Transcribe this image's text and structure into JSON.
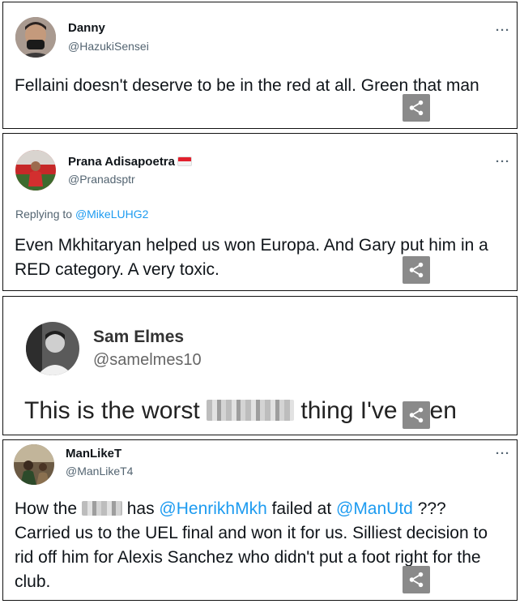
{
  "tweets": [
    {
      "name": "Danny",
      "handle": "@HazukiSensei",
      "more": "···",
      "text": "Fellaini doesn't deserve to be in the red at all. Green that man"
    },
    {
      "name": "Prana Adisapoetra",
      "flag": "indonesia-flag",
      "handle": "@Pranadsptr",
      "more": "···",
      "replying_to_prefix": "Replying to ",
      "replying_to": "@MikeLUHG2",
      "text": "Even Mkhitaryan helped us won Europa. And Gary put him in a RED category. A very toxic."
    },
    {
      "name": "Sam Elmes",
      "handle": "@samelmes10",
      "text_before": "This is the worst ",
      "text_after": " thing I've seen"
    },
    {
      "name": "ManLikeT",
      "handle": "@ManLikeT4",
      "more": "···",
      "t1": "How the ",
      "t2": " has ",
      "mention1": "@HenrikhMkh",
      "t3": " failed at ",
      "mention2": "@ManUtd",
      "t4": " ??? Carried us to the UEL final and won it for us. Silliest decision to rid off him for Alexis Sanchez who didn't put a foot right for the club."
    }
  ],
  "icons": {
    "share": "share-icon",
    "more": "more-icon"
  },
  "colors": {
    "mention": "#1d9bf0",
    "secondary_text": "#536471",
    "share_bg": "#8a8a8a"
  }
}
